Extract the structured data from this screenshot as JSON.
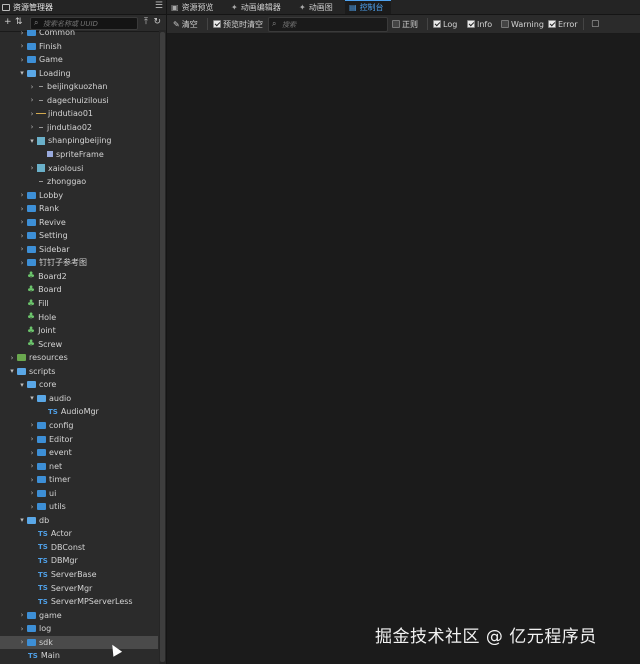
{
  "left_panel": {
    "title": "资源管理器",
    "search_placeholder": "搜索名称或 UUID"
  },
  "tree": [
    {
      "label": "Common",
      "indent": 1,
      "arrow": "right",
      "icon": "folder"
    },
    {
      "label": "Finish",
      "indent": 1,
      "arrow": "right",
      "icon": "folder"
    },
    {
      "label": "Game",
      "indent": 1,
      "arrow": "right",
      "icon": "folder"
    },
    {
      "label": "Loading",
      "indent": 1,
      "arrow": "down",
      "icon": "folder-open"
    },
    {
      "label": "beijingkuozhan",
      "indent": 2,
      "arrow": "right",
      "icon": "dot"
    },
    {
      "label": "dagechuizilousi",
      "indent": 2,
      "arrow": "right",
      "icon": "dot"
    },
    {
      "label": "jindutiao01",
      "indent": 2,
      "arrow": "right",
      "icon": "line"
    },
    {
      "label": "jindutiao02",
      "indent": 2,
      "arrow": "right",
      "icon": "dot"
    },
    {
      "label": "shanpingbeijing",
      "indent": 2,
      "arrow": "down",
      "icon": "image"
    },
    {
      "label": "spriteFrame",
      "indent": 3,
      "arrow": "none",
      "icon": "sprite"
    },
    {
      "label": "xaiolousi",
      "indent": 2,
      "arrow": "right",
      "icon": "image"
    },
    {
      "label": "zhonggao",
      "indent": 2,
      "arrow": "none",
      "icon": "dot"
    },
    {
      "label": "Lobby",
      "indent": 1,
      "arrow": "right",
      "icon": "folder"
    },
    {
      "label": "Rank",
      "indent": 1,
      "arrow": "right",
      "icon": "folder"
    },
    {
      "label": "Revive",
      "indent": 1,
      "arrow": "right",
      "icon": "folder"
    },
    {
      "label": "Setting",
      "indent": 1,
      "arrow": "right",
      "icon": "folder"
    },
    {
      "label": "Sidebar",
      "indent": 1,
      "arrow": "right",
      "icon": "folder"
    },
    {
      "label": "钉钉子参考图",
      "indent": 1,
      "arrow": "right",
      "icon": "folder"
    },
    {
      "label": "Board2",
      "indent": 1,
      "arrow": "none",
      "icon": "prefab"
    },
    {
      "label": "Board",
      "indent": 1,
      "arrow": "none",
      "icon": "prefab"
    },
    {
      "label": "Fill",
      "indent": 1,
      "arrow": "none",
      "icon": "prefab"
    },
    {
      "label": "Hole",
      "indent": 1,
      "arrow": "none",
      "icon": "prefab"
    },
    {
      "label": "Joint",
      "indent": 1,
      "arrow": "none",
      "icon": "prefab"
    },
    {
      "label": "Screw",
      "indent": 1,
      "arrow": "none",
      "icon": "prefab"
    },
    {
      "label": "resources",
      "indent": 0,
      "arrow": "right",
      "icon": "folder-res"
    },
    {
      "label": "scripts",
      "indent": 0,
      "arrow": "down",
      "icon": "folder-open"
    },
    {
      "label": "core",
      "indent": 1,
      "arrow": "down",
      "icon": "folder-open"
    },
    {
      "label": "audio",
      "indent": 2,
      "arrow": "down",
      "icon": "folder-open"
    },
    {
      "label": "AudioMgr",
      "indent": 3,
      "arrow": "none",
      "icon": "ts"
    },
    {
      "label": "config",
      "indent": 2,
      "arrow": "right",
      "icon": "folder"
    },
    {
      "label": "Editor",
      "indent": 2,
      "arrow": "right",
      "icon": "folder"
    },
    {
      "label": "event",
      "indent": 2,
      "arrow": "right",
      "icon": "folder"
    },
    {
      "label": "net",
      "indent": 2,
      "arrow": "right",
      "icon": "folder"
    },
    {
      "label": "timer",
      "indent": 2,
      "arrow": "right",
      "icon": "folder"
    },
    {
      "label": "ui",
      "indent": 2,
      "arrow": "right",
      "icon": "folder"
    },
    {
      "label": "utils",
      "indent": 2,
      "arrow": "right",
      "icon": "folder"
    },
    {
      "label": "db",
      "indent": 1,
      "arrow": "down",
      "icon": "folder-open"
    },
    {
      "label": "Actor",
      "indent": 2,
      "arrow": "none",
      "icon": "ts"
    },
    {
      "label": "DBConst",
      "indent": 2,
      "arrow": "none",
      "icon": "ts"
    },
    {
      "label": "DBMgr",
      "indent": 2,
      "arrow": "none",
      "icon": "ts"
    },
    {
      "label": "ServerBase",
      "indent": 2,
      "arrow": "none",
      "icon": "ts"
    },
    {
      "label": "ServerMgr",
      "indent": 2,
      "arrow": "none",
      "icon": "ts"
    },
    {
      "label": "ServerMPServerLess",
      "indent": 2,
      "arrow": "none",
      "icon": "ts"
    },
    {
      "label": "game",
      "indent": 1,
      "arrow": "right",
      "icon": "folder"
    },
    {
      "label": "log",
      "indent": 1,
      "arrow": "right",
      "icon": "folder"
    },
    {
      "label": "sdk",
      "indent": 1,
      "arrow": "right",
      "icon": "folder",
      "selected": true
    },
    {
      "label": "Main",
      "indent": 1,
      "arrow": "none",
      "icon": "ts"
    }
  ],
  "tabs": [
    {
      "label": "资源预览",
      "icon": "preview-icon"
    },
    {
      "label": "动画编辑器",
      "icon": "animation-editor-icon"
    },
    {
      "label": "动画图",
      "icon": "animation-graph-icon"
    },
    {
      "label": "控制台",
      "icon": "console-icon",
      "active": true
    }
  ],
  "toolbar": {
    "clear_label": "清空",
    "clear_on_preview_label": "预览时清空",
    "search_placeholder": "搜索",
    "regex_label": "正则",
    "log_label": "Log",
    "info_label": "Info",
    "warning_label": "Warning",
    "error_label": "Error"
  },
  "watermark": "掘金技术社区 @ 亿元程序员",
  "colors": {
    "accent": "#4fa3f0",
    "folder": "#3d8fd6",
    "prefab": "#6cc56c",
    "script": "#4f9fe6"
  }
}
